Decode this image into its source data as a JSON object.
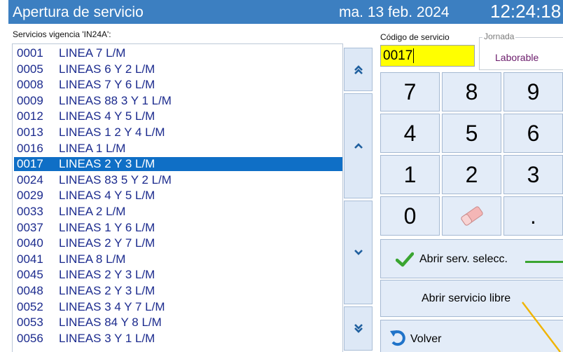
{
  "window": {
    "title": "Apertura de servicio",
    "date": "ma. 13 feb. 2024",
    "time": "12:24:18"
  },
  "services": {
    "caption": "Servicios vigencia 'IN24A':",
    "selected_index": 7,
    "items": [
      {
        "code": "0001",
        "name": "LINEA 7 L/M"
      },
      {
        "code": "0005",
        "name": "LINEAS 6 Y 2 L/M"
      },
      {
        "code": "0008",
        "name": "LINEAS 7 Y 6 L/M"
      },
      {
        "code": "0009",
        "name": "LINEAS 88 3 Y 1 L/M"
      },
      {
        "code": "0012",
        "name": "LINEAS 4 Y 5 L/M"
      },
      {
        "code": "0013",
        "name": "LINEAS 1 2 Y 4 L/M"
      },
      {
        "code": "0016",
        "name": "LINEA 1 L/M"
      },
      {
        "code": "0017",
        "name": "LINEAS 2 Y 3 L/M"
      },
      {
        "code": "0024",
        "name": "LINEAS 83 5 Y 2 L/M"
      },
      {
        "code": "0029",
        "name": "LINEAS 4 Y 5 L/M"
      },
      {
        "code": "0033",
        "name": "LINEA 2 L/M"
      },
      {
        "code": "0037",
        "name": "LINEAS 1 Y 6 L/M"
      },
      {
        "code": "0040",
        "name": "LINEAS 2 Y 7 L/M"
      },
      {
        "code": "0041",
        "name": "LINEA 8 L/M"
      },
      {
        "code": "0045",
        "name": "LINEAS 2 Y 3 L/M"
      },
      {
        "code": "0048",
        "name": "LINEAS 2 Y 3 L/M"
      },
      {
        "code": "0052",
        "name": "LINEAS 3 4 Y 7 L/M"
      },
      {
        "code": "0053",
        "name": "LINEAS 84 Y 8 L/M"
      },
      {
        "code": "0056",
        "name": "LINEAS 3 Y 1 L/M"
      }
    ]
  },
  "scroll_buttons": {
    "page_up_icon": "double-chevron-up-icon",
    "up_icon": "chevron-up-icon",
    "down_icon": "chevron-down-icon",
    "page_down_icon": "double-chevron-down-icon"
  },
  "code_entry": {
    "label": "Código de servicio",
    "value": "0017"
  },
  "jornada": {
    "label": "Jornada",
    "value": "Laborable"
  },
  "keypad": {
    "keys": [
      "7",
      "8",
      "9",
      "4",
      "5",
      "6",
      "1",
      "2",
      "3",
      "0",
      "",
      "."
    ],
    "eraser_icon": "eraser-icon"
  },
  "actions": {
    "open_selected": "Abrir serv. selecc.",
    "open_free": "Abrir servicio libre",
    "back": "Volver"
  },
  "colors": {
    "titlebar": "#3c7fc1",
    "selection": "#0f6fc6",
    "list_text": "#1c2b8e",
    "code_input_bg": "#ffff00",
    "check_green": "#3aa531",
    "annotation_line": "#f0b400"
  }
}
